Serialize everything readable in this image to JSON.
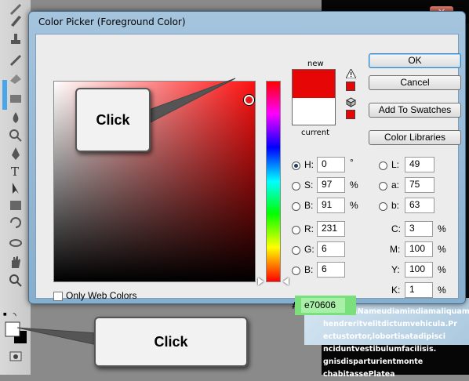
{
  "dialog": {
    "title": "Color Picker (Foreground Color)",
    "new_label": "new",
    "current_label": "current",
    "new_color": "#e70606",
    "current_color": "#ffffff"
  },
  "buttons": {
    "ok": "OK",
    "cancel": "Cancel",
    "add_to_swatches": "Add To Swatches",
    "color_libraries": "Color Libraries"
  },
  "hsb": {
    "h_label": "H:",
    "h_value": "0",
    "h_unit": "°",
    "s_label": "S:",
    "s_value": "97",
    "s_unit": "%",
    "b_label": "B:",
    "b_value": "91",
    "b_unit": "%"
  },
  "rgb": {
    "r_label": "R:",
    "r_value": "231",
    "g_label": "G:",
    "g_value": "6",
    "b_label": "B:",
    "b_value": "6"
  },
  "lab": {
    "l_label": "L:",
    "l_value": "49",
    "a_label": "a:",
    "a_value": "75",
    "b_label": "b:",
    "b_value": "63"
  },
  "cmyk": {
    "c_label": "C:",
    "c_value": "3",
    "m_label": "M:",
    "m_value": "100",
    "y_label": "Y:",
    "y_value": "100",
    "k_label": "K:",
    "k_value": "1",
    "unit": "%"
  },
  "hex": {
    "hash": "#",
    "value": "e70606"
  },
  "only_web_colors": "Only Web Colors",
  "callouts": {
    "top": "Click",
    "bottom": "Click"
  },
  "background_doc": {
    "lines": [
      "tempus.Nameudiamindiamaliquam",
      "hendreritvelitdictumvehicula.Pr",
      "ectustortor,lobortisatadipisci",
      "nciduntvestibulumfacilisis.",
      "gnisdisparturientmonte",
      "chabitassePlatea"
    ]
  },
  "accent_color": "#e70606"
}
